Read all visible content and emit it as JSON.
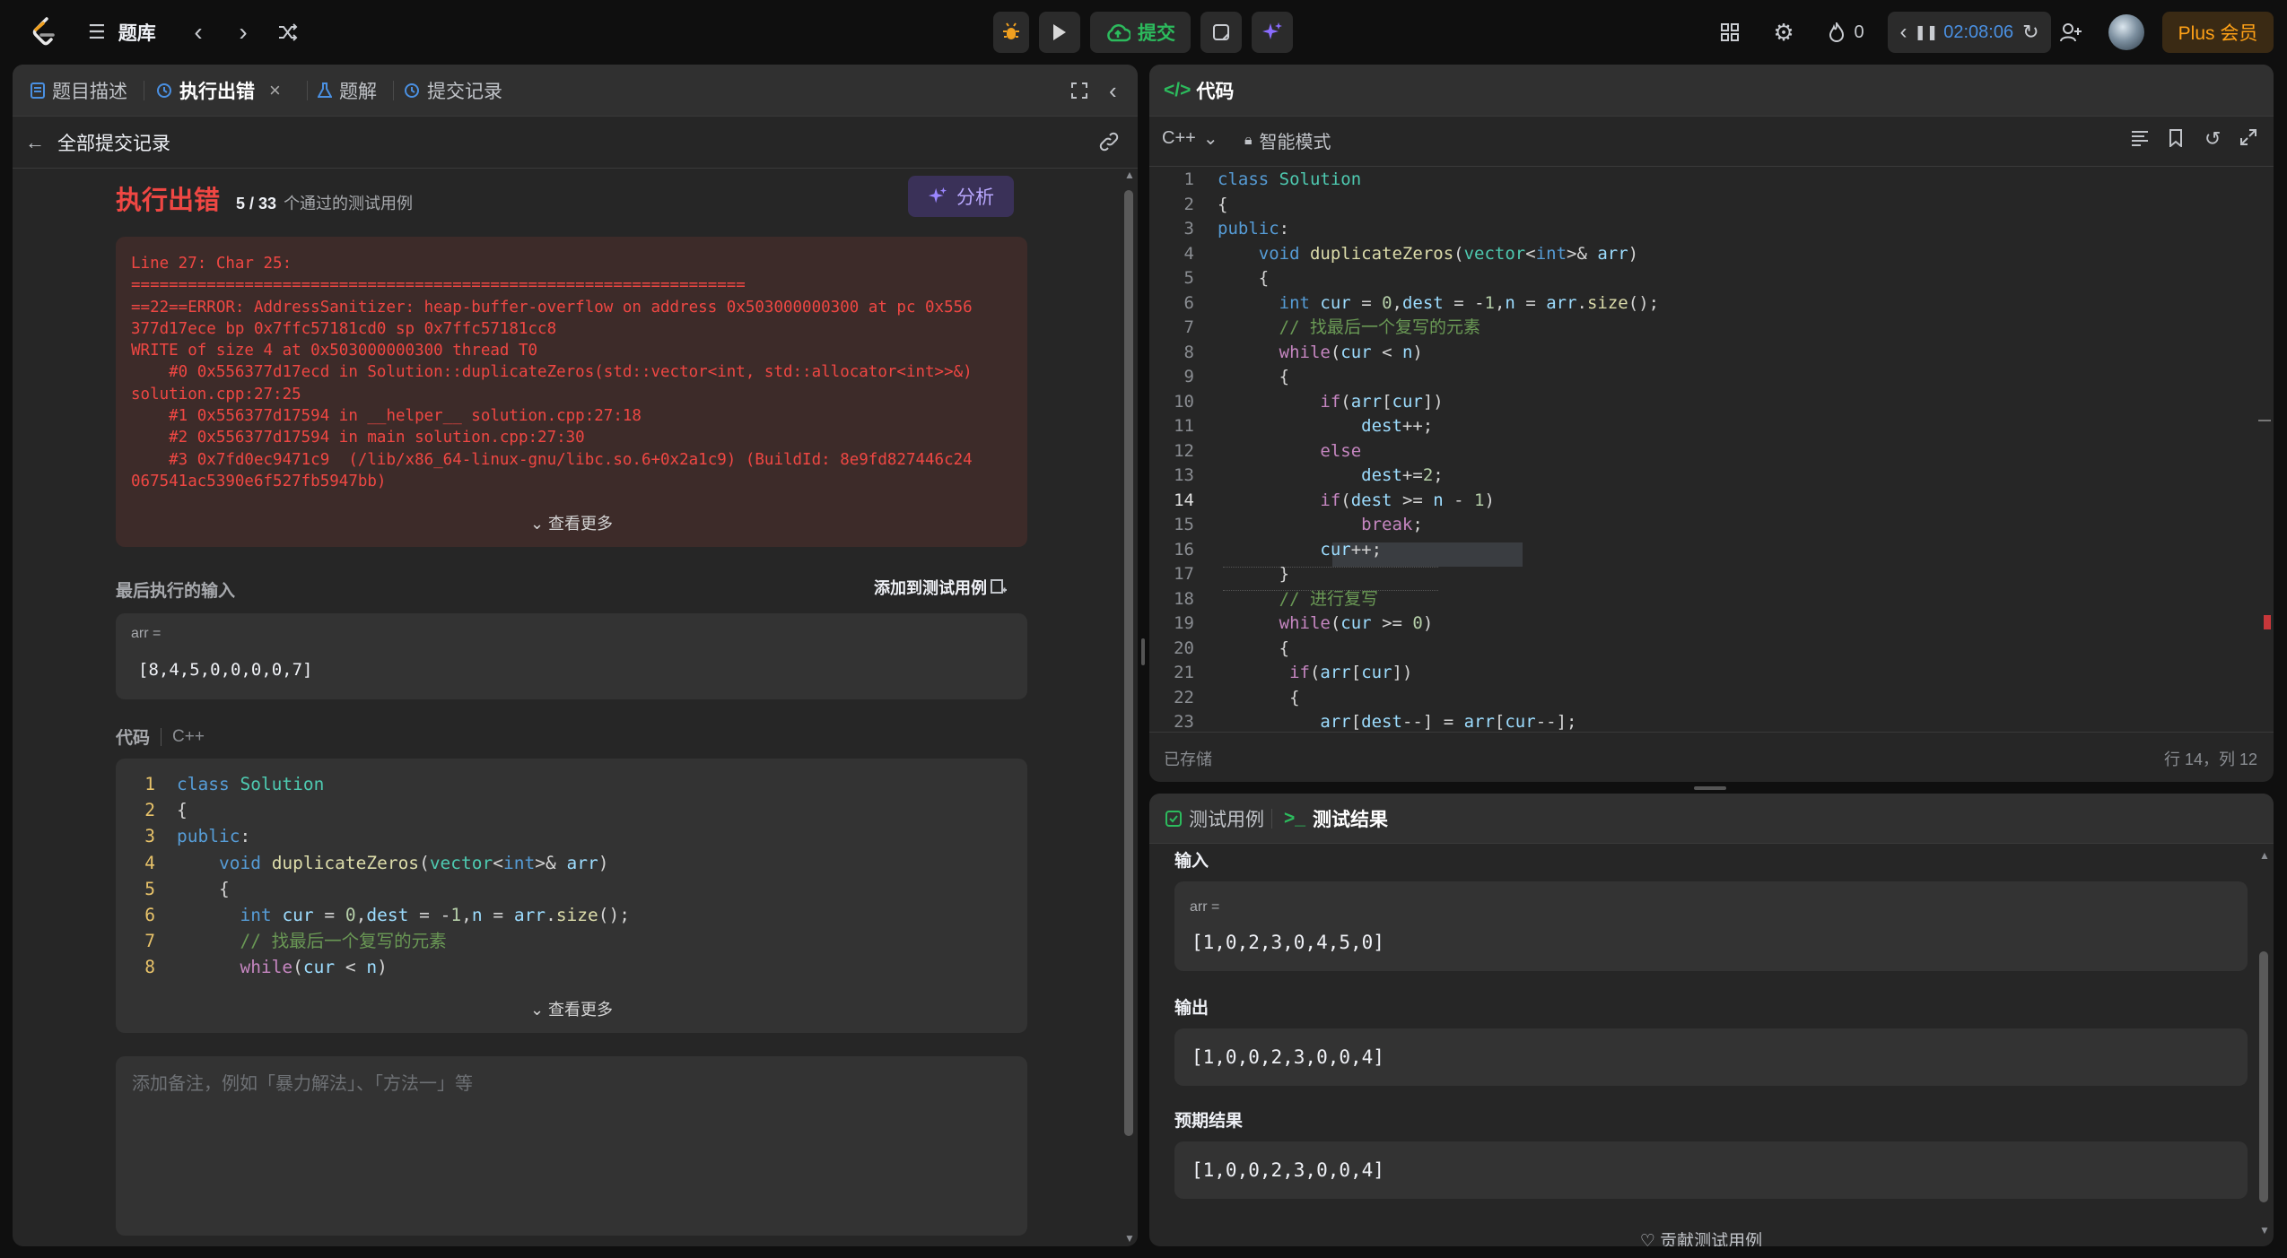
{
  "topbar": {
    "problem_bank": "题库",
    "submit": "提交",
    "fire_count": "0",
    "timer": "02:08:06",
    "plus": "Plus 会员"
  },
  "left": {
    "tabs": [
      "题目描述",
      "执行出错",
      "题解",
      "提交记录"
    ],
    "back_label": "全部提交记录",
    "status": "执行出错",
    "passed": "5 / 33",
    "passed_suffix": "个通过的测试用例",
    "analyze": "分析",
    "error_lines": [
      "Line 27: Char 25:",
      "=================================================================",
      "==22==ERROR: AddressSanitizer: heap-buffer-overflow on address 0x503000000300 at pc 0x556",
      "377d17ece bp 0x7ffc57181cd0 sp 0x7ffc57181cc8",
      "WRITE of size 4 at 0x503000000300 thread T0",
      "    #0 0x556377d17ecd in Solution::duplicateZeros(std::vector<int, std::allocator<int>>&)",
      "solution.cpp:27:25",
      "    #1 0x556377d17594 in __helper__ solution.cpp:27:18",
      "    #2 0x556377d17594 in main solution.cpp:27:30",
      "    #3 0x7fd0ec9471c9  (/lib/x86_64-linux-gnu/libc.so.6+0x2a1c9) (BuildId: 8e9fd827446c24",
      "067541ac5390e6f527fb5947bb)"
    ],
    "see_more": "查看更多",
    "last_input_title": "最后执行的输入",
    "add_testcase": "添加到测试用例",
    "input_var": "arr =",
    "input_value": "[8,4,5,0,0,0,0,7]",
    "code_title": "代码",
    "code_lang": "C++",
    "see_more2": "查看更多",
    "note_placeholder": "添加备注，例如「暴力解法」、「方法一」等"
  },
  "editor": {
    "title": "代码",
    "lang": "C++",
    "mode": "智能模式",
    "saved": "已存储",
    "cursor": "行 14，列 12"
  },
  "results": {
    "tab_cases": "测试用例",
    "tab_results": "测试结果",
    "input_label": "输入",
    "input_var": "arr =",
    "input_value": "[1,0,2,3,0,4,5,0]",
    "output_label": "输出",
    "output_value": "[1,0,0,2,3,0,0,4]",
    "expected_label": "预期结果",
    "expected_value": "[1,0,0,2,3,0,0,4]",
    "contribute": "贡献测试用例"
  },
  "colors": {
    "error_red": "#ef4743",
    "submit_green": "#2cbb5d",
    "accent_purple": "#8a6cff",
    "timer_blue": "#4a90e2",
    "plus_orange": "#ffa116"
  }
}
